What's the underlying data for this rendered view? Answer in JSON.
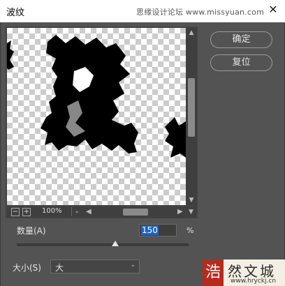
{
  "window": {
    "title": "波纹",
    "watermark_text": "思缘设计论坛 www.missyuan.com",
    "close_label": "✕"
  },
  "preview": {
    "zoom_level": "100%",
    "zoom_out_label": "−",
    "zoom_in_label": "+",
    "scroll_up": "▲",
    "scroll_down": "▼",
    "scroll_left": "◀",
    "scroll_right": "▶",
    "dropdown_chevron": "⌄"
  },
  "buttons": {
    "ok_label": "确定",
    "reset_label": "复位"
  },
  "amount": {
    "label": "数量(A)",
    "value": "150",
    "unit": "%"
  },
  "size": {
    "label": "大小(S)",
    "selected": "大",
    "chevron": "⌄"
  },
  "logo": {
    "seal_char": "浩",
    "site_name": "然文城",
    "url": "www.hryckj.cn"
  },
  "colors": {
    "panel_bg": "#535353",
    "selection_blue": "#1a64c8"
  }
}
